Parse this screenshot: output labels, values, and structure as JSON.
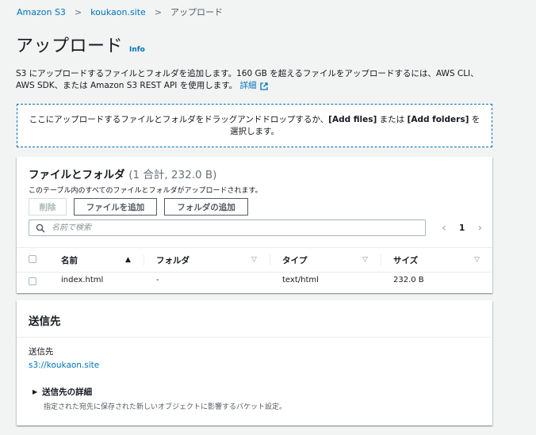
{
  "breadcrumb": {
    "items": [
      "Amazon S3",
      "koukaon.site"
    ],
    "current": "アップロード",
    "separator": ">"
  },
  "page": {
    "title": "アップロード",
    "info": "Info"
  },
  "description": {
    "text": "S3 にアップロードするファイルとフォルダを追加します。160 GB を超えるファイルをアップロードするには、AWS CLI、AWS SDK、または Amazon S3 REST API を使用します。",
    "link": "詳細"
  },
  "dropzone": {
    "prefix": "ここにアップロードするファイルとフォルダをドラッグアンドドロップするか、",
    "add_files": "[Add files]",
    "middle": " または ",
    "add_folders": "[Add folders]",
    "suffix": " を選択します。"
  },
  "files_panel": {
    "title": "ファイルとフォルダ",
    "count": "(1 合計, 232.0 B)",
    "subtitle": "このテーブル内のすべてのファイルとフォルダがアップロードされます。",
    "buttons": {
      "delete": "削除",
      "add_files": "ファイルを追加",
      "add_folder": "フォルダの追加"
    },
    "search_placeholder": "名前で検索",
    "pager": {
      "prev": "‹",
      "page": "1",
      "next": "›"
    },
    "columns": [
      "名前",
      "フォルダ",
      "タイプ",
      "サイズ"
    ],
    "rows": [
      {
        "name": "index.html",
        "folder": "-",
        "type": "text/html",
        "size": "232.0 B"
      }
    ]
  },
  "destination": {
    "title": "送信先",
    "label": "送信先",
    "link": "s3://koukaon.site",
    "details_title": "送信先の詳細",
    "details_desc": "指定された宛先に保存された新しいオブジェクトに影響するバケット設定。"
  },
  "colors": {
    "background": "#f2f3f3",
    "link": "#0073bb",
    "border": "#aab7b8"
  }
}
